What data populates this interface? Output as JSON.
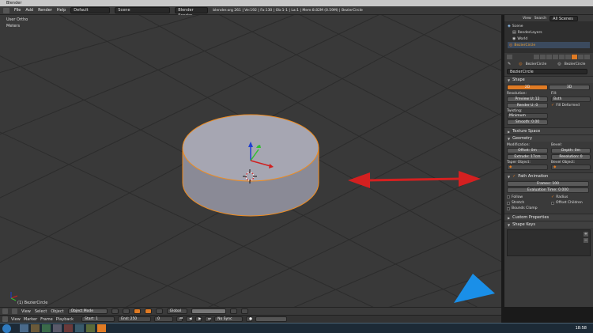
{
  "window": {
    "title": "Blender"
  },
  "menubar": {
    "items": [
      "File",
      "Add",
      "Render",
      "Help"
    ],
    "screen_layout": "Default",
    "scene": "Scene",
    "engine": "Blender Render",
    "stats": "blender.org 261 | Ve:192 | Fa:130 | Ob:1-1 | La:1 | Mem:8.82M (0.59M) | BezierCircle"
  },
  "viewport": {
    "view_label": "User Ortho",
    "unit_label": "Meters",
    "object_label": "(1) BezierCircle"
  },
  "header3d": {
    "items": [
      "View",
      "Select",
      "Object"
    ],
    "mode": "Object Mode",
    "pivot": "Global"
  },
  "timeline": {
    "items": [
      "View",
      "Marker",
      "Frame",
      "Playback"
    ],
    "start": "Start: 1",
    "end": "End: 250",
    "current": "0",
    "sync": "No Sync"
  },
  "outliner": {
    "header": [
      "View",
      "Search",
      "All Scenes"
    ],
    "tree": [
      "Scene",
      "RenderLayers",
      "World",
      "BezierCircle"
    ]
  },
  "properties": {
    "context_object": "BezierCircle",
    "context_data": "BezierCircle",
    "datablock": "BezierCircle",
    "shape": {
      "title": "Shape",
      "dim_2d": "2D",
      "dim_3d": "3D",
      "resolution_label": "Resolution:",
      "preview": "Preview U: 12",
      "render": "Render U: 0",
      "fill_label": "Fill:",
      "fill_value": "Both",
      "fill_deformed": "Fill Deformed",
      "twisting_label": "Twisting:",
      "twisting_value": "Minimum",
      "smooth": "Smooth: 0.00"
    },
    "texture_space": {
      "title": "Texture Space"
    },
    "geometry": {
      "title": "Geometry",
      "modification_label": "Modification:",
      "offset": "Offset: 0m",
      "extrude": "Extrude: 17cm",
      "bevel_label": "Bevel:",
      "depth": "Depth: 0m",
      "resolution": "Resolution: 0",
      "taper_label": "Taper Object:",
      "bevel_obj_label": "Bevel Object:"
    },
    "path_animation": {
      "title": "Path Animation",
      "frames": "Frames: 100",
      "eval_time": "Evaluation Time: 0.000",
      "follow": "Follow",
      "radius": "Radius",
      "stretch": "Stretch",
      "offset_children": "Offset Children",
      "bounds_clamp": "Bounds Clamp"
    },
    "custom_properties": {
      "title": "Custom Properties"
    },
    "shape_keys": {
      "title": "Shape Keys"
    }
  },
  "taskbar": {
    "clock": "18:58"
  },
  "colors": {
    "accent": "#e07b24",
    "selection_outline": "#f08c1e",
    "annotation_arrow": "#d42020",
    "annotation_triangle": "#1a8fe8"
  }
}
